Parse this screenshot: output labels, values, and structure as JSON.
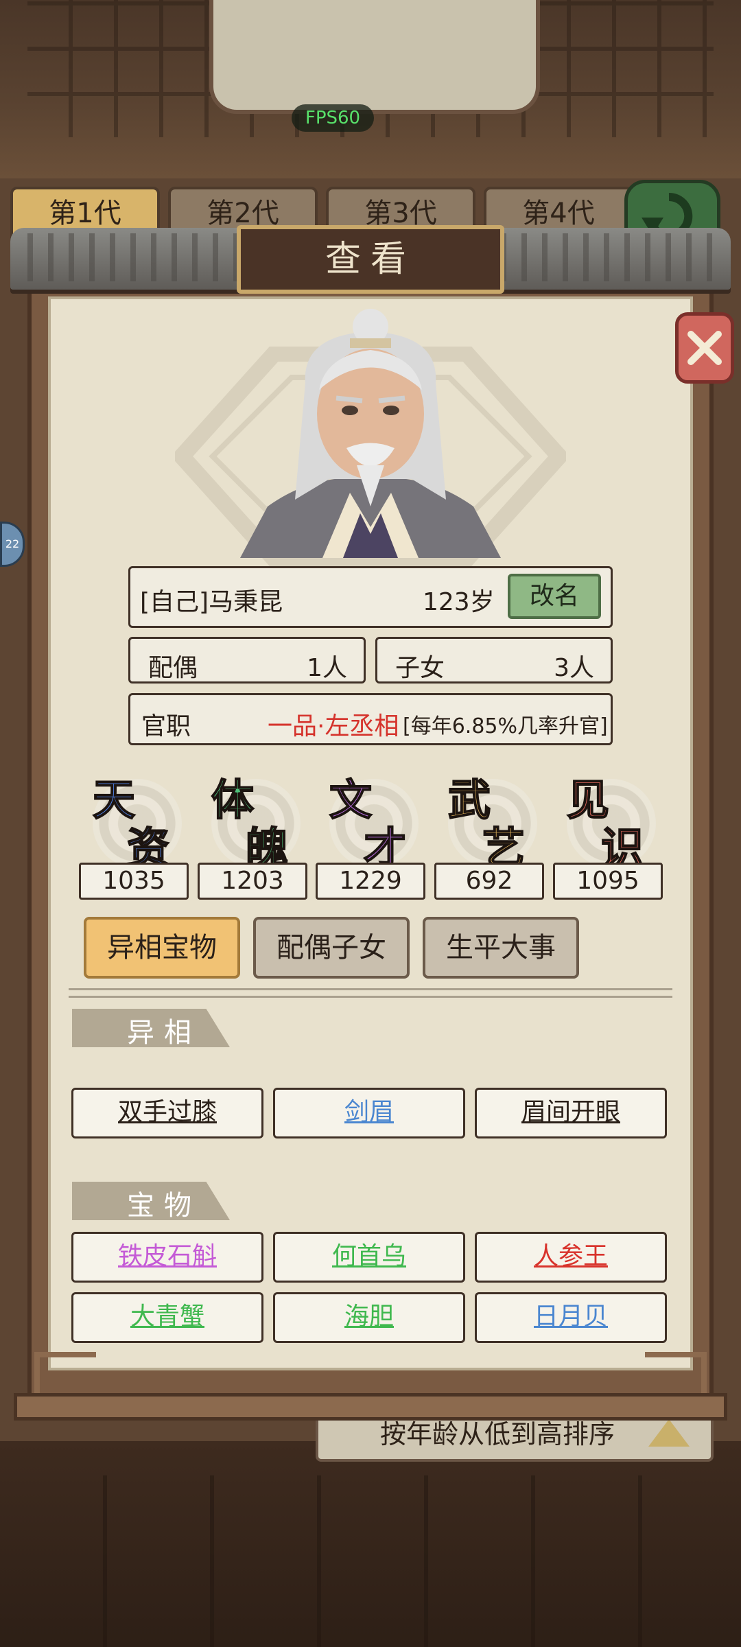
{
  "fps": "FPS60",
  "generation_tabs": [
    "第1代",
    "第2代",
    "第3代",
    "第4代"
  ],
  "side_badge": "22",
  "dialog": {
    "title": "查看"
  },
  "character": {
    "name": "[自己]马秉昆",
    "age": "123岁",
    "rename_label": "改名",
    "spouse_label": "配偶",
    "spouse_count": "1人",
    "children_label": "子女",
    "children_count": "3人",
    "official_label": "官职",
    "official_value": "一品·左丞相",
    "promotion_note": "[每年6.85%几率升官]"
  },
  "stats": [
    {
      "c1": "天",
      "c2": "资",
      "value": "1035",
      "color": "#4e7fe0"
    },
    {
      "c1": "体",
      "c2": "魄",
      "value": "1203",
      "color": "#4fc07a"
    },
    {
      "c1": "文",
      "c2": "才",
      "value": "1229",
      "color": "#b36ad9"
    },
    {
      "c1": "武",
      "c2": "艺",
      "value": "692",
      "color": "#e3b35a"
    },
    {
      "c1": "见",
      "c2": "识",
      "value": "1095",
      "color": "#e46a5e"
    }
  ],
  "sub_tabs": [
    "异相宝物",
    "配偶子女",
    "生平大事"
  ],
  "sections": {
    "traits_title": "异相",
    "treasures_title": "宝物"
  },
  "traits": [
    {
      "label": "双手过膝",
      "color": "#2a2019"
    },
    {
      "label": "剑眉",
      "color": "#4a86d0"
    },
    {
      "label": "眉间开眼",
      "color": "#2a2019"
    }
  ],
  "treasures": [
    {
      "label": "铁皮石斛",
      "color": "#c45ad6"
    },
    {
      "label": "何首乌",
      "color": "#3fb84e"
    },
    {
      "label": "人参王",
      "color": "#d8322b"
    },
    {
      "label": "大青蟹",
      "color": "#3fb84e"
    },
    {
      "label": "海胆",
      "color": "#3fb84e"
    },
    {
      "label": "日月贝",
      "color": "#4a86d0"
    }
  ],
  "sort_label": "按年龄从低到高排序"
}
